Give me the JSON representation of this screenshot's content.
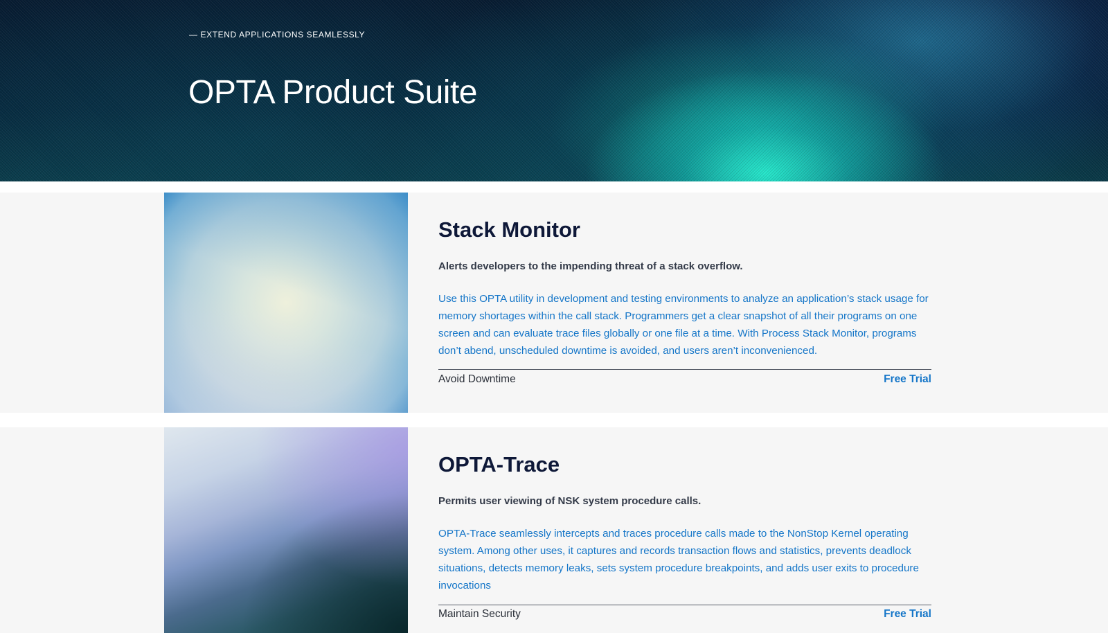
{
  "hero": {
    "eyebrow": "— EXTEND APPLICATIONS SEAMLESSLY",
    "title": "OPTA Product Suite"
  },
  "products": [
    {
      "title": "Stack Monitor",
      "tagline": "Alerts developers to the impending threat of a stack overflow.",
      "description": "Use this OPTA utility in development and testing environments to analyze an application’s stack usage for memory shortages within the call stack. Programmers get a clear snapshot of all their programs on one screen and can evaluate trace files globally or one file at a time. With Process Stack Monitor, programs don’t abend, unscheduled downtime is avoided, and users aren’t inconvenienced.",
      "footer_label": "Avoid Downtime",
      "cta_label": "Free Trial"
    },
    {
      "title": "OPTA-Trace",
      "tagline": "Permits user viewing of NSK system procedure calls.",
      "description": "OPTA-Trace seamlessly intercepts and traces procedure calls made to the NonStop Kernel operating system. Among other uses, it captures and records transaction flows and statistics, prevents deadlock situations, detects memory leaks, sets system procedure breakpoints, and adds user exits to procedure invocations",
      "footer_label": "Maintain Security",
      "cta_label": "Free Trial"
    }
  ],
  "colors": {
    "link": "#1576c8",
    "heading": "#0e1838",
    "panel_background": "#f6f6f6"
  }
}
